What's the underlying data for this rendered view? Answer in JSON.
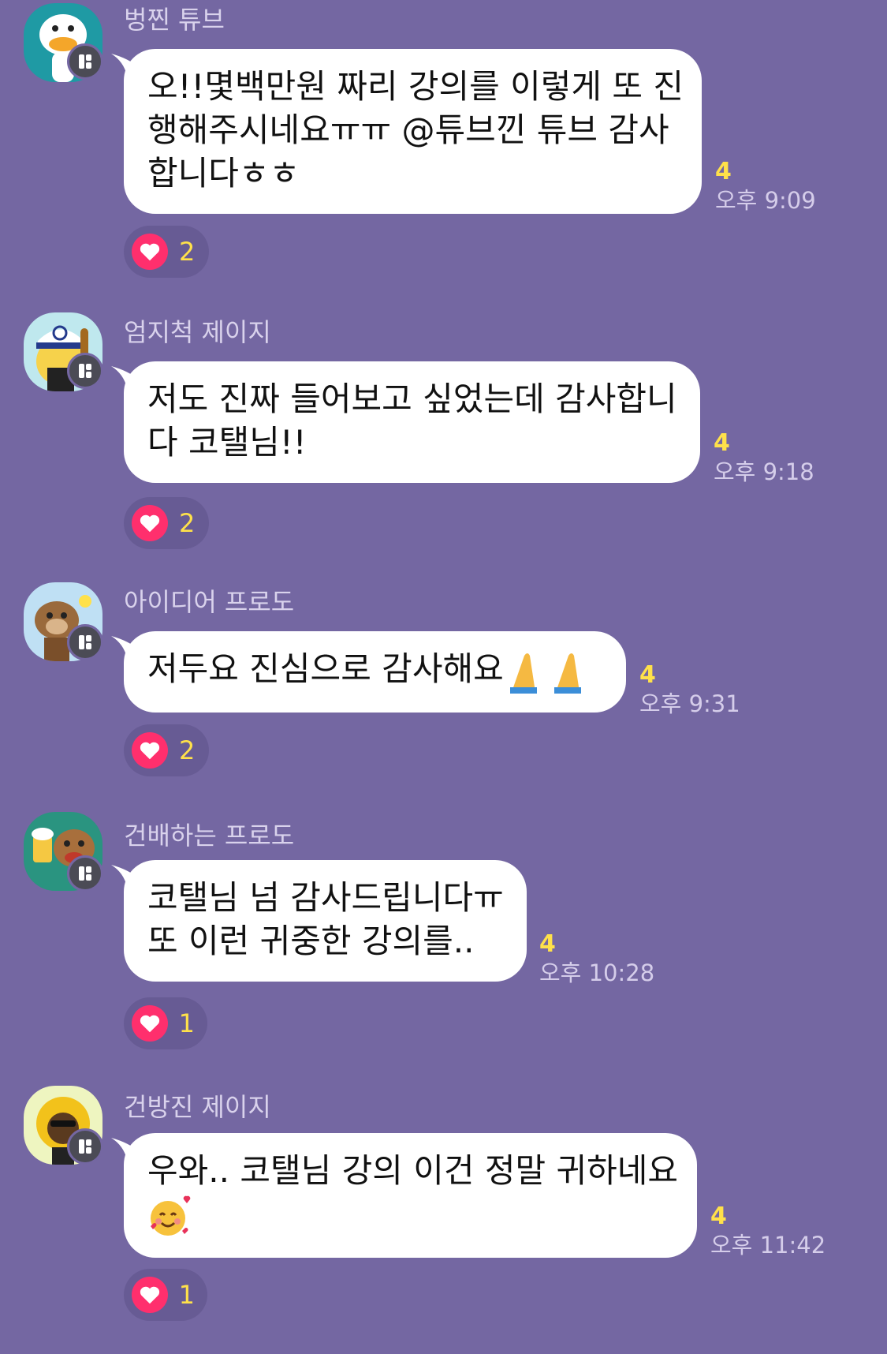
{
  "colors": {
    "background": "#7467a2",
    "bubble": "#ffffff",
    "read_count": "#ffe14a",
    "timestamp": "#d5cdea",
    "heart": "#ff2f6d"
  },
  "messages": [
    {
      "sender": "벙찐 튜브",
      "avatar_icon": "tube-duck-avatar-icon",
      "lines": [
        "오!!몇백만원 짜리 강의를 이렇게 또 진",
        "행해주시네요ㅠㅠ @튜브낀 튜브  감사",
        "합니다ㅎㅎ"
      ],
      "read_count": "4",
      "time": "오후 9:09",
      "reaction_icon": "heart-icon",
      "reaction_count": "2"
    },
    {
      "sender": "엄지척 제이지",
      "avatar_icon": "jay-g-thumbs-up-avatar-icon",
      "lines": [
        "저도 진짜 들어보고 싶었는데 감사합니",
        "다 코탤님!!"
      ],
      "read_count": "4",
      "time": "오후 9:18",
      "reaction_icon": "heart-icon",
      "reaction_count": "2"
    },
    {
      "sender": "아이디어 프로도",
      "avatar_icon": "frodo-idea-avatar-icon",
      "lines": [
        "저두요 진심으로 감사해요"
      ],
      "emoji": "folded-hands-emoji",
      "read_count": "4",
      "time": "오후 9:31",
      "reaction_icon": "heart-icon",
      "reaction_count": "2"
    },
    {
      "sender": "건배하는 프로도",
      "avatar_icon": "frodo-cheers-avatar-icon",
      "lines": [
        "코탤님 넘 감사드립니다ㅠ",
        "또 이런 귀중한 강의를.."
      ],
      "read_count": "4",
      "time": "오후 10:28",
      "reaction_icon": "heart-icon",
      "reaction_count": "1"
    },
    {
      "sender": "건방진 제이지",
      "avatar_icon": "jay-g-sunglasses-avatar-icon",
      "lines": [
        "우와.. 코탤님 강의 이건 정말 귀하네요"
      ],
      "emoji": "smiling-face-with-hearts-emoji",
      "read_count": "4",
      "time": "오후 11:42",
      "reaction_icon": "heart-icon",
      "reaction_count": "1"
    }
  ]
}
